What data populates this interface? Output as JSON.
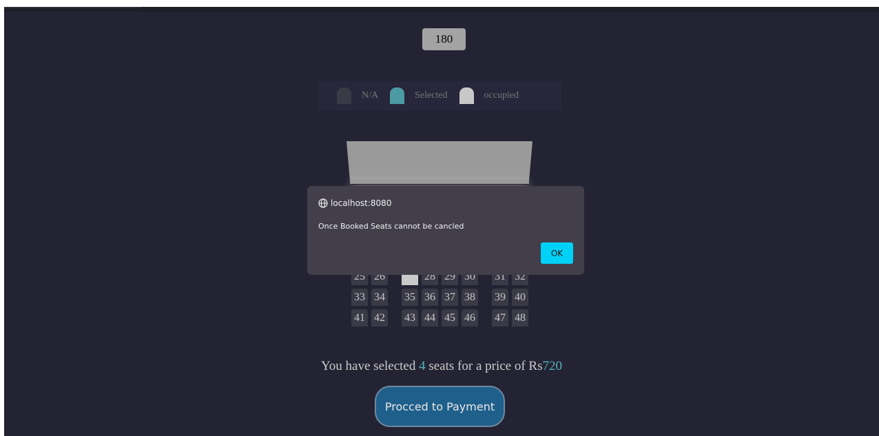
{
  "price_select": {
    "value": "180"
  },
  "legend": [
    {
      "label": "N/A",
      "color": "#3a3946"
    },
    {
      "label": "Selected",
      "color": "#4c9aa4"
    },
    {
      "label": "occupied",
      "color": "#c8c8c8"
    }
  ],
  "seats": {
    "rows": [
      [
        {
          "n": "25"
        },
        {
          "n": "26"
        },
        {
          "n": "27",
          "occupied": true
        },
        {
          "n": "28"
        },
        {
          "n": "29"
        },
        {
          "n": "30"
        },
        {
          "n": "31"
        },
        {
          "n": "32"
        }
      ],
      [
        {
          "n": "33"
        },
        {
          "n": "34"
        },
        {
          "n": "35"
        },
        {
          "n": "36"
        },
        {
          "n": "37"
        },
        {
          "n": "38"
        },
        {
          "n": "39"
        },
        {
          "n": "40"
        }
      ],
      [
        {
          "n": "41"
        },
        {
          "n": "42"
        },
        {
          "n": "43"
        },
        {
          "n": "44"
        },
        {
          "n": "45"
        },
        {
          "n": "46"
        },
        {
          "n": "47"
        },
        {
          "n": "48"
        }
      ]
    ]
  },
  "summary": {
    "prefix": "You have selected ",
    "count": "4",
    "middle": " seats for a price of Rs",
    "total": "720"
  },
  "pay_button": {
    "label": "Procced to Payment"
  },
  "dialog": {
    "origin": "localhost:8080",
    "message": "Once Booked Seats cannot be cancled",
    "ok_label": "OK"
  },
  "colors": {
    "background": "#242333",
    "selected": "#4c9aa4",
    "ok_button": "#00d2f7",
    "pay_button": "#1f5f8b"
  }
}
